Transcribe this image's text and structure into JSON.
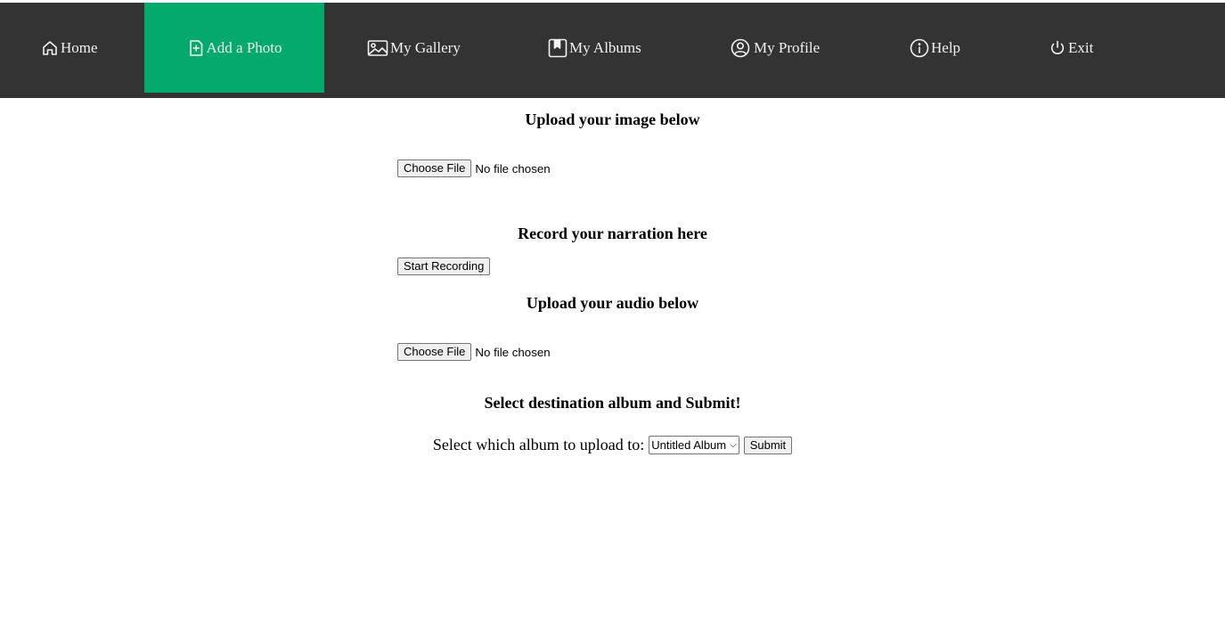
{
  "nav": {
    "home": {
      "label": "Home",
      "icon": "house-icon"
    },
    "add_photo": {
      "label": "Add a Photo",
      "icon": "file-plus-icon",
      "active_color": "#04aa6d"
    },
    "gallery": {
      "label": "My Gallery",
      "icon": "image-icon"
    },
    "albums": {
      "label": "My Albums",
      "icon": "bookmark-icon"
    },
    "profile": {
      "label": "My Profile",
      "icon": "person-circle-icon"
    },
    "help": {
      "label": "Help",
      "icon": "info-circle-icon"
    },
    "exit": {
      "label": "Exit",
      "icon": "power-icon"
    },
    "background": "#333333"
  },
  "image_upload": {
    "heading": "Upload your image below",
    "button_label": "Choose File",
    "status": "No file chosen"
  },
  "narration": {
    "heading": "Record your narration here",
    "button_label": "Start Recording"
  },
  "audio_upload": {
    "heading": "Upload your audio below",
    "button_label": "Choose File",
    "status": "No file chosen"
  },
  "destination": {
    "heading": "Select destination album and Submit!",
    "select_label": "Select which album to upload to:",
    "selected_album": "Untitled Album",
    "submit_label": "Submit"
  }
}
